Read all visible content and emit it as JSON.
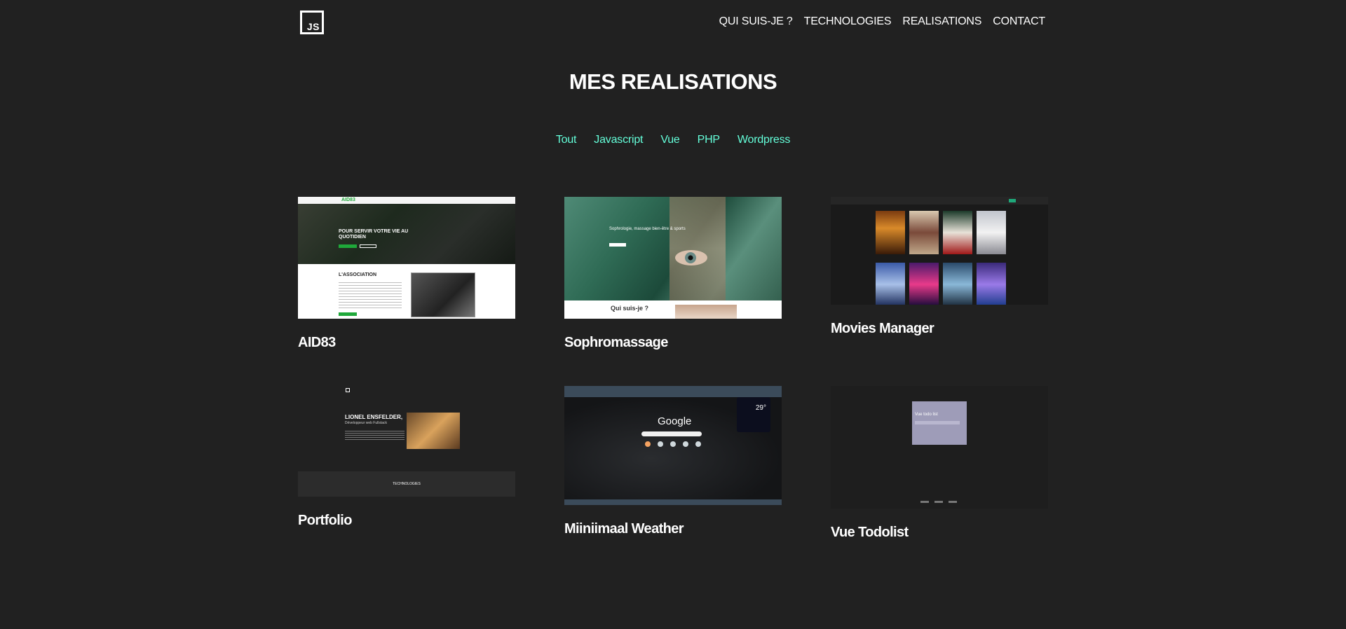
{
  "header": {
    "logo_text": "JS",
    "nav": [
      "QUI SUIS-JE ?",
      "TECHNOLOGIES",
      "REALISATIONS",
      "CONTACT"
    ]
  },
  "main": {
    "title": "MES REALISATIONS",
    "filters": [
      "Tout",
      "Javascript",
      "Vue",
      "PHP",
      "Wordpress"
    ],
    "projects": [
      {
        "title": "AID83",
        "thumb_brand": "AID83",
        "thumb_headline": "POUR SERVIR VOTRE VIE AU QUOTIDIEN",
        "thumb_section": "L'ASSOCIATION"
      },
      {
        "title": "Sophromassage",
        "thumb_tagline": "Sophrologie, massage bien-être & sports",
        "thumb_section": "Qui suis-je ?"
      },
      {
        "title": "Movies Manager"
      },
      {
        "title": "Portfolio",
        "thumb_name": "LIONEL ENSFELDER,",
        "thumb_sub": "Développeur web Fullstack",
        "thumb_section": "TECHNOLOGIES"
      },
      {
        "title": "Miiniimaal Weather",
        "thumb_search": "Google",
        "thumb_temp": "29°"
      },
      {
        "title": "Vue Todolist",
        "thumb_heading": "Vue todo list"
      }
    ]
  },
  "colors": {
    "background": "#212121",
    "accent": "#64ffda",
    "text": "#ffffff"
  }
}
